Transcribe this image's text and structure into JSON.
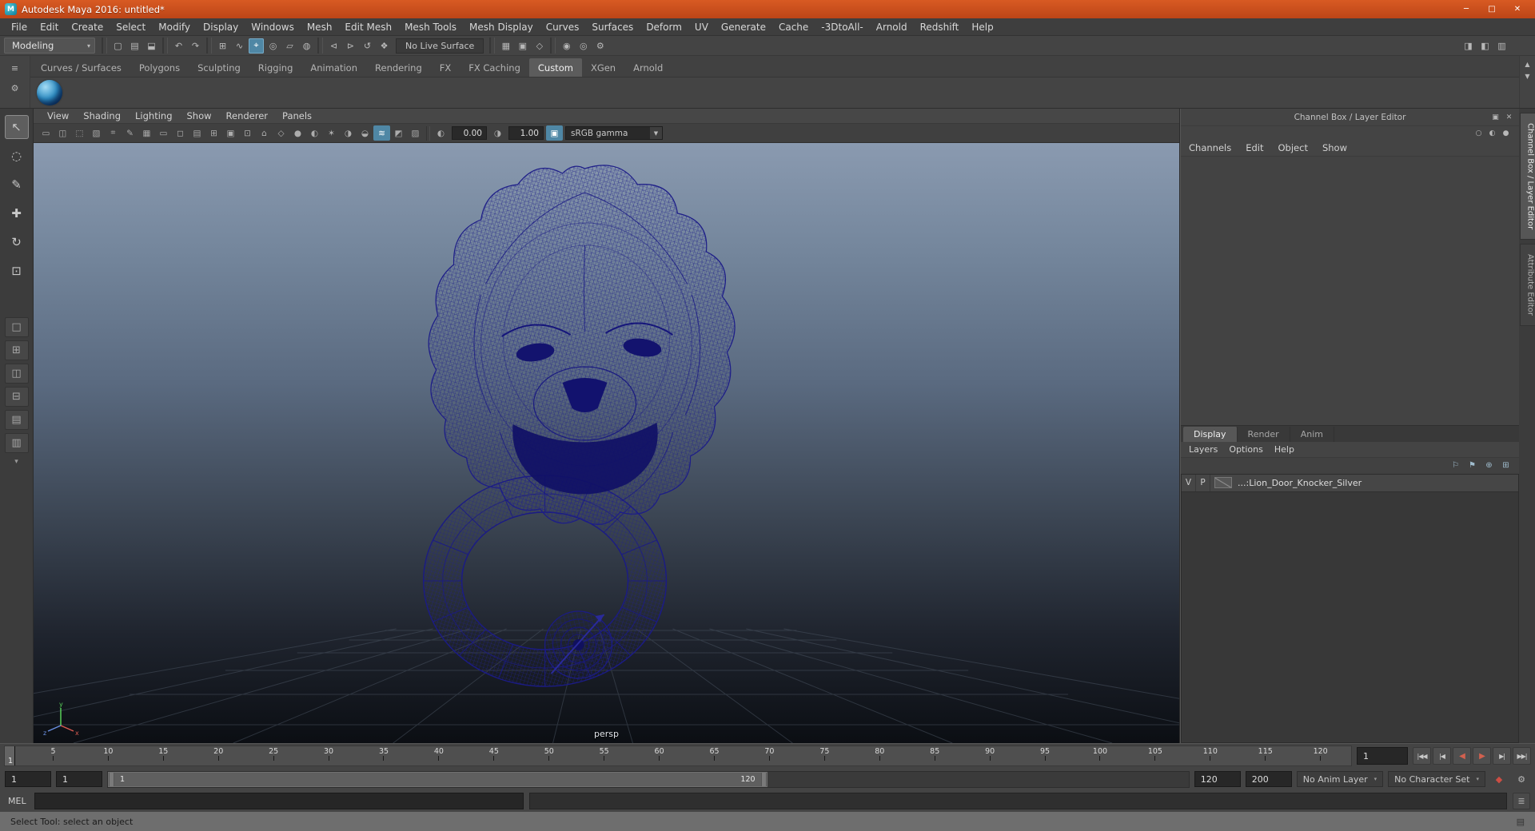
{
  "window": {
    "title": "Autodesk Maya 2016: untitled*",
    "logo_letter": "M",
    "minimize": "─",
    "maximize": "□",
    "close": "✕"
  },
  "menubar": {
    "items": [
      "File",
      "Edit",
      "Create",
      "Select",
      "Modify",
      "Display",
      "Windows",
      "Mesh",
      "Edit Mesh",
      "Mesh Tools",
      "Mesh Display",
      "Curves",
      "Surfaces",
      "Deform",
      "UV",
      "Generate",
      "Cache",
      "-3DtoAll-",
      "Arnold",
      "Redshift",
      "Help"
    ]
  },
  "statusline": {
    "workspace": "Modeling",
    "workspace_arrow": "▾",
    "scene_icons": [
      {
        "name": "new-scene-icon",
        "glyph": "▢"
      },
      {
        "name": "open-scene-icon",
        "glyph": "▤"
      },
      {
        "name": "save-scene-icon",
        "glyph": "⬓"
      }
    ],
    "undo_icons": [
      {
        "name": "undo-icon",
        "glyph": "↶"
      },
      {
        "name": "redo-icon",
        "glyph": "↷"
      }
    ],
    "snap_icons": [
      {
        "name": "snap-to-grids-icon",
        "glyph": "⊞"
      },
      {
        "name": "snap-to-curves-icon",
        "glyph": "∿"
      },
      {
        "name": "snap-to-points-icon",
        "glyph": "⌖"
      },
      {
        "name": "snap-to-projected-center-icon",
        "glyph": "◎"
      },
      {
        "name": "snap-to-view-planes-icon",
        "glyph": "▱"
      },
      {
        "name": "make-live-icon",
        "glyph": "◍"
      }
    ],
    "snap_active": 2,
    "history_icons": [
      {
        "name": "input-connections-icon",
        "glyph": "⊲"
      },
      {
        "name": "output-connections-icon",
        "glyph": "⊳"
      },
      {
        "name": "construction-history-icon",
        "glyph": "↺"
      },
      {
        "name": "show-manipulator-icon",
        "glyph": "❖"
      }
    ],
    "live_surface": "No Live Surface",
    "display_icons": [
      {
        "name": "grid-display-icon",
        "glyph": "▦"
      },
      {
        "name": "isolate-display-icon",
        "glyph": "▣"
      },
      {
        "name": "wireframe-display-icon",
        "glyph": "◇"
      }
    ],
    "render_icons": [
      {
        "name": "render-current-frame-icon",
        "glyph": "◉"
      },
      {
        "name": "ipr-render-icon",
        "glyph": "◎"
      },
      {
        "name": "render-settings-icon",
        "glyph": "⚙"
      }
    ],
    "sidebar_icons": [
      {
        "name": "toggle-attribute-editor-icon",
        "glyph": "◨"
      },
      {
        "name": "toggle-tool-settings-icon",
        "glyph": "◧"
      },
      {
        "name": "toggle-channel-box-icon",
        "glyph": "▥"
      }
    ]
  },
  "shelf": {
    "menu_icon": "≡",
    "gear_icon": "⚙",
    "tabs": [
      "Curves / Surfaces",
      "Polygons",
      "Sculpting",
      "Rigging",
      "Animation",
      "Rendering",
      "FX",
      "FX Caching",
      "Custom",
      "XGen",
      "Arnold"
    ],
    "active_tab": "Custom",
    "scroll_up": "▲",
    "scroll_down": "▼"
  },
  "toolbox": {
    "tools": [
      {
        "name": "select-tool-icon",
        "glyph": "↖"
      },
      {
        "name": "lasso-select-tool-icon",
        "glyph": "◌"
      },
      {
        "name": "paint-selection-tool-icon",
        "glyph": "✎"
      },
      {
        "name": "move-tool-icon",
        "glyph": "✚"
      },
      {
        "name": "rotate-tool-icon",
        "glyph": "↻"
      },
      {
        "name": "scale-tool-icon",
        "glyph": "⊡"
      }
    ],
    "active_tool": 0,
    "layouts": [
      {
        "name": "single-pane-layout-button",
        "glyph": "□"
      },
      {
        "name": "four-pane-layout-button",
        "glyph": "⊞"
      },
      {
        "name": "two-pane-side-layout-button",
        "glyph": "◫"
      },
      {
        "name": "two-pane-stacked-layout-button",
        "glyph": "⊟"
      },
      {
        "name": "three-pane-layout-button",
        "glyph": "▤"
      },
      {
        "name": "outliner-persp-layout-button",
        "glyph": "▥"
      }
    ],
    "more_arrow": "▾"
  },
  "panel": {
    "menus": [
      "View",
      "Shading",
      "Lighting",
      "Show",
      "Renderer",
      "Panels"
    ],
    "toolbar_icons": [
      {
        "name": "lock-camera-icon",
        "glyph": "▭"
      },
      {
        "name": "camera-attributes-icon",
        "glyph": "◫"
      },
      {
        "name": "bookmark-icon",
        "glyph": "⬚"
      },
      {
        "name": "image-plane-icon",
        "glyph": "▧"
      },
      {
        "name": "2d-pan-zoom-icon",
        "glyph": "⌗"
      },
      {
        "name": "grease-pencil-icon",
        "glyph": "✎"
      },
      {
        "name": "grid-toggle-icon",
        "glyph": "▦"
      },
      {
        "name": "film-gate-icon",
        "glyph": "▭"
      },
      {
        "name": "resolution-gate-icon",
        "glyph": "◻"
      },
      {
        "name": "gate-mask-icon",
        "glyph": "▤"
      },
      {
        "name": "field-chart-icon",
        "glyph": "⊞"
      },
      {
        "name": "safe-action-icon",
        "glyph": "▣"
      },
      {
        "name": "safe-title-icon",
        "glyph": "⊡"
      },
      {
        "name": "frame-all-icon",
        "glyph": "⌂"
      },
      {
        "name": "wireframe-mode-icon",
        "glyph": "◇"
      },
      {
        "name": "shaded-mode-icon",
        "glyph": "●"
      },
      {
        "name": "textured-mode-icon",
        "glyph": "◐"
      },
      {
        "name": "use-all-lights-icon",
        "glyph": "✶"
      },
      {
        "name": "shadows-icon",
        "glyph": "◑"
      },
      {
        "name": "occlusion-icon",
        "glyph": "◒"
      },
      {
        "name": "motion-blur-icon",
        "glyph": "≋"
      },
      {
        "name": "isolate-select-icon",
        "glyph": "◩"
      },
      {
        "name": "xray-icon",
        "glyph": "▨"
      }
    ],
    "toolbar_active": 20,
    "exposure_icon": "◐",
    "exposure": "0.00",
    "gamma_icon": "◑",
    "gamma": "1.00",
    "color_mgmt_icon": "▣",
    "colorspace": "sRGB gamma",
    "dropdown_arrow": "▼",
    "camera_label": "persp",
    "axis": {
      "x": "x",
      "y": "y",
      "z": "z"
    }
  },
  "channel_box": {
    "title": "Channel Box / Layer Editor",
    "title_icons": [
      {
        "name": "dock-panel-icon",
        "glyph": "▣"
      },
      {
        "name": "close-panel-icon",
        "glyph": "✕"
      }
    ],
    "manip_icons": [
      {
        "name": "no-manip-icon",
        "glyph": "○"
      },
      {
        "name": "invisible-manip-icon",
        "glyph": "◐"
      },
      {
        "name": "standard-manip-icon",
        "glyph": "●"
      }
    ],
    "menus": [
      "Channels",
      "Edit",
      "Object",
      "Show"
    ],
    "tabs": [
      "Display",
      "Render",
      "Anim"
    ],
    "active_tab": "Display",
    "layer_menus": [
      "Layers",
      "Options",
      "Help"
    ],
    "layer_toolbar_icons": [
      {
        "name": "layer-visibility-sync-icon",
        "glyph": "⚐"
      },
      {
        "name": "layer-playback-sync-icon",
        "glyph": "⚑"
      },
      {
        "name": "create-empty-layer-icon",
        "glyph": "⊕"
      },
      {
        "name": "create-layer-from-selected-icon",
        "glyph": "⊞"
      }
    ],
    "layer": {
      "visible": "V",
      "playback": "P",
      "name": "...:Lion_Door_Knocker_Silver"
    }
  },
  "sidebar": {
    "tabs": [
      {
        "label": "Channel Box / Layer Editor"
      },
      {
        "label": "Attribute Editor"
      }
    ],
    "active": "Channel Box / Layer Editor"
  },
  "timeline": {
    "ticks": [
      "5",
      "10",
      "15",
      "20",
      "25",
      "30",
      "35",
      "40",
      "45",
      "50",
      "55",
      "60",
      "65",
      "70",
      "75",
      "80",
      "85",
      "90",
      "95",
      "100",
      "105",
      "110",
      "115",
      "120"
    ],
    "current_frame": "1",
    "current_time_field": "1",
    "transport": [
      {
        "name": "go-to-start-button",
        "glyph": "|◀◀"
      },
      {
        "name": "step-back-button",
        "glyph": "|◀"
      },
      {
        "name": "play-backwards-button",
        "glyph": "◀"
      },
      {
        "name": "play-forwards-button",
        "glyph": "▶"
      },
      {
        "name": "step-forward-button",
        "glyph": "▶|"
      },
      {
        "name": "go-to-end-button",
        "glyph": "▶▶|"
      }
    ]
  },
  "range": {
    "anim_start": "1",
    "playback_start": "1",
    "bar_start": "1",
    "bar_end": "120",
    "playback_end": "120",
    "anim_end": "200",
    "anim_layer": "No Anim Layer",
    "character_set": "No Character Set",
    "dropdown_arrow": "▾",
    "auto_key_icon": "◆",
    "prefs_icon": "⚙"
  },
  "command_line": {
    "label": "MEL",
    "script_icon": "≣"
  },
  "help_line": {
    "text": "Select Tool: select an object",
    "icon": "▤"
  },
  "colors": {
    "titlebar": "#c94b1d",
    "accent": "#4f87a5",
    "wireframe": "#1d1d88"
  }
}
